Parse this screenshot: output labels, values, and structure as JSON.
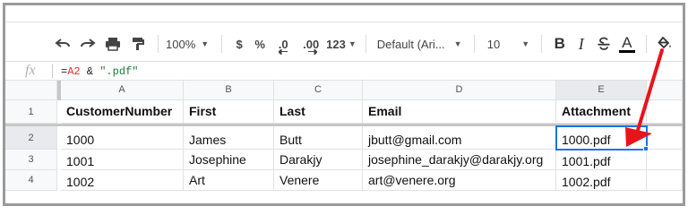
{
  "toolbar": {
    "zoom": "100%",
    "currency": "$",
    "percent": "%",
    "decrease_decimal": ".0",
    "increase_decimal": ".00",
    "more_formats": "123",
    "font": "Default (Ari...",
    "font_size": "10",
    "bold": "B",
    "italic": "I",
    "text_color": "A"
  },
  "formula_bar": {
    "fx_label": "fx",
    "ref": "=A2",
    "op": " & ",
    "literal": "\".pdf\""
  },
  "columns": [
    "A",
    "B",
    "C",
    "D",
    "E"
  ],
  "rows": [
    {
      "num": "1",
      "cells": [
        "CustomerNumber",
        "First",
        "Last",
        "Email",
        "Attachment"
      ]
    },
    {
      "num": "2",
      "cells": [
        "1000",
        "James",
        "Butt",
        "jbutt@gmail.com",
        "1000.pdf"
      ]
    },
    {
      "num": "3",
      "cells": [
        "1001",
        "Josephine",
        "Darakjy",
        "josephine_darakjy@darakjy.org",
        "1001.pdf"
      ]
    },
    {
      "num": "4",
      "cells": [
        "1002",
        "Art",
        "Venere",
        "art@venere.org",
        "1002.pdf"
      ]
    }
  ],
  "selected_cell": "E2",
  "colors": {
    "selection": "#1a73e8",
    "annotation_arrow": "#e8141b",
    "formula_reference": "#d93025",
    "formula_string": "#188038"
  }
}
